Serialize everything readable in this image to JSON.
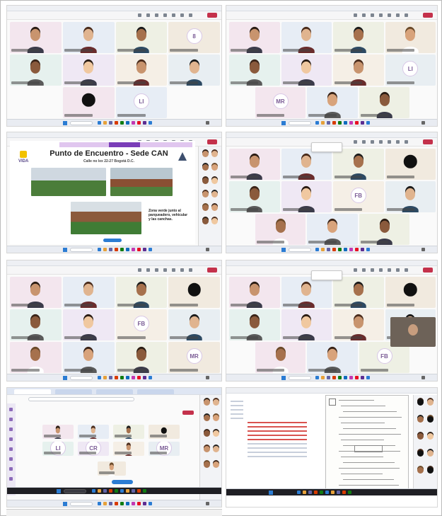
{
  "slide": {
    "logo_text": "VIDA",
    "title": "Punto de Encuentro - Sede CAN",
    "subtitle": "Calle no lex 22-27 Bogotá D.C.",
    "note": "Zona verde junto al parqueadero, vehicular y las canchas."
  },
  "initials": [
    "8",
    "LI",
    "LI",
    "MR",
    "FB",
    "FB",
    "MR",
    "FB",
    "LI",
    "CR",
    "MR",
    "FB"
  ],
  "colors": {
    "leave_button": "#c4314b",
    "taskbar_start": "#2b7cd3",
    "slide_accent": "#7a3db8",
    "slide_banner": "#e0c6ef"
  }
}
